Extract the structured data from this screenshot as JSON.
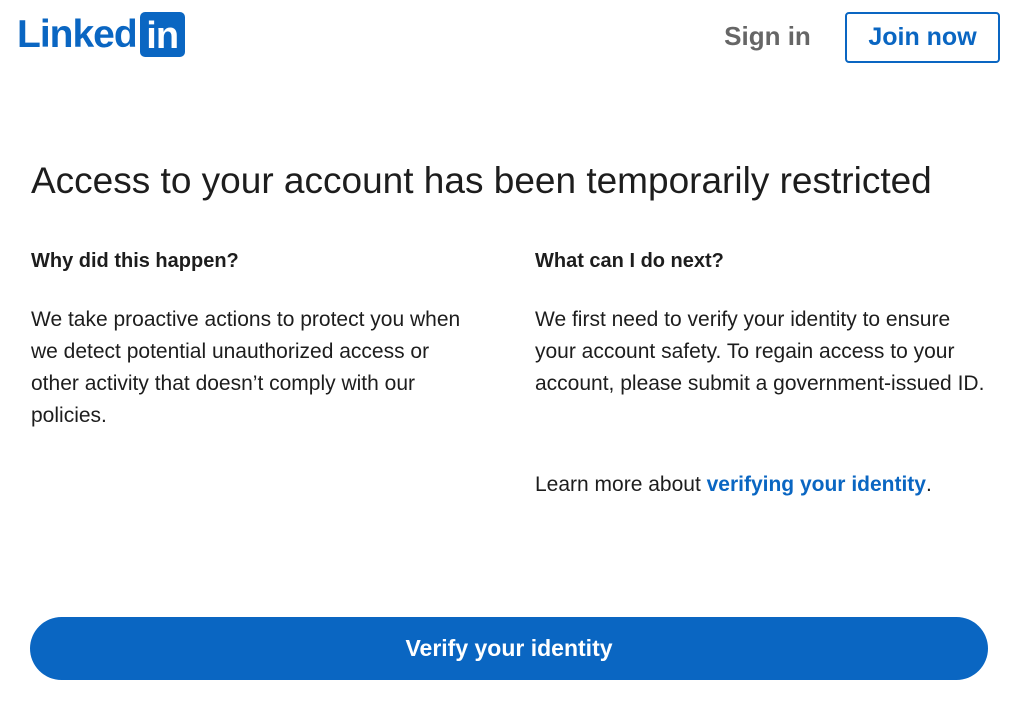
{
  "header": {
    "logo": {
      "text": "Linked",
      "box_text": "in"
    },
    "signin_label": "Sign in",
    "joinnow_label": "Join now"
  },
  "main": {
    "title": "Access to your account has been temporarily restricted",
    "why": {
      "heading": "Why did this happen?",
      "body": "We take proactive actions to protect you when we detect potential unauthorized access or other activity that doesn’t comply with our policies."
    },
    "next": {
      "heading": "What can I do next?",
      "body": "We first need to verify your identity to ensure your account safety. To regain access to your account, please submit a government-issued ID."
    },
    "learn_more": {
      "prefix": "Learn more about ",
      "link_text": "verifying your identity",
      "suffix": "."
    },
    "verify_button_label": "Verify your identity"
  },
  "colors": {
    "brand": "#0a66c2",
    "text": "#1d1d1d",
    "muted": "#666666"
  }
}
